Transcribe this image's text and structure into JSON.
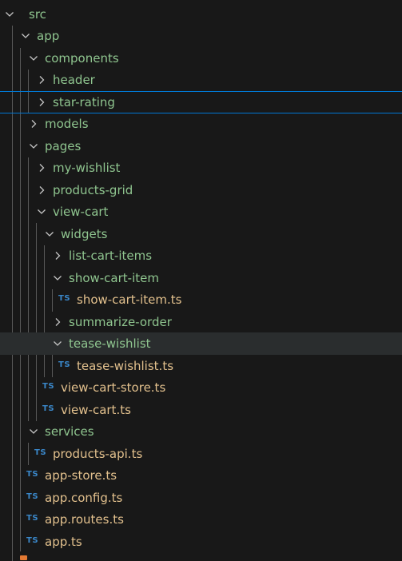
{
  "colors": {
    "background": "#181818",
    "folder_text": "#8fc58f",
    "file_text": "#e2c08d",
    "ts_icon": "#3a87c9",
    "chevron": "#c5c5c5",
    "focus_border": "#0078d4",
    "hover_background": "#2a2d2e"
  },
  "explorer": {
    "items": [
      {
        "label": "src",
        "type": "folder",
        "expanded": true
      },
      {
        "label": "app",
        "type": "folder",
        "expanded": true
      },
      {
        "label": "components",
        "type": "folder",
        "expanded": true
      },
      {
        "label": "header",
        "type": "folder",
        "expanded": false
      },
      {
        "label": "star-rating",
        "type": "folder",
        "expanded": false,
        "focused": true
      },
      {
        "label": "models",
        "type": "folder",
        "expanded": false
      },
      {
        "label": "pages",
        "type": "folder",
        "expanded": true
      },
      {
        "label": "my-wishlist",
        "type": "folder",
        "expanded": false
      },
      {
        "label": "products-grid",
        "type": "folder",
        "expanded": false
      },
      {
        "label": "view-cart",
        "type": "folder",
        "expanded": true
      },
      {
        "label": "widgets",
        "type": "folder",
        "expanded": true
      },
      {
        "label": "list-cart-items",
        "type": "folder",
        "expanded": false
      },
      {
        "label": "show-cart-item",
        "type": "folder",
        "expanded": true
      },
      {
        "label": "show-cart-item.ts",
        "type": "file",
        "icon": "TS"
      },
      {
        "label": "summarize-order",
        "type": "folder",
        "expanded": false
      },
      {
        "label": "tease-wishlist",
        "type": "folder",
        "expanded": true,
        "hovered": true
      },
      {
        "label": "tease-wishlist.ts",
        "type": "file",
        "icon": "TS"
      },
      {
        "label": "view-cart-store.ts",
        "type": "file",
        "icon": "TS"
      },
      {
        "label": "view-cart.ts",
        "type": "file",
        "icon": "TS"
      },
      {
        "label": "services",
        "type": "folder",
        "expanded": true
      },
      {
        "label": "products-api.ts",
        "type": "file",
        "icon": "TS"
      },
      {
        "label": "app-store.ts",
        "type": "file",
        "icon": "TS"
      },
      {
        "label": "app.config.ts",
        "type": "file",
        "icon": "TS"
      },
      {
        "label": "app.routes.ts",
        "type": "file",
        "icon": "TS"
      },
      {
        "label": "app.ts",
        "type": "file",
        "icon": "TS"
      }
    ]
  }
}
